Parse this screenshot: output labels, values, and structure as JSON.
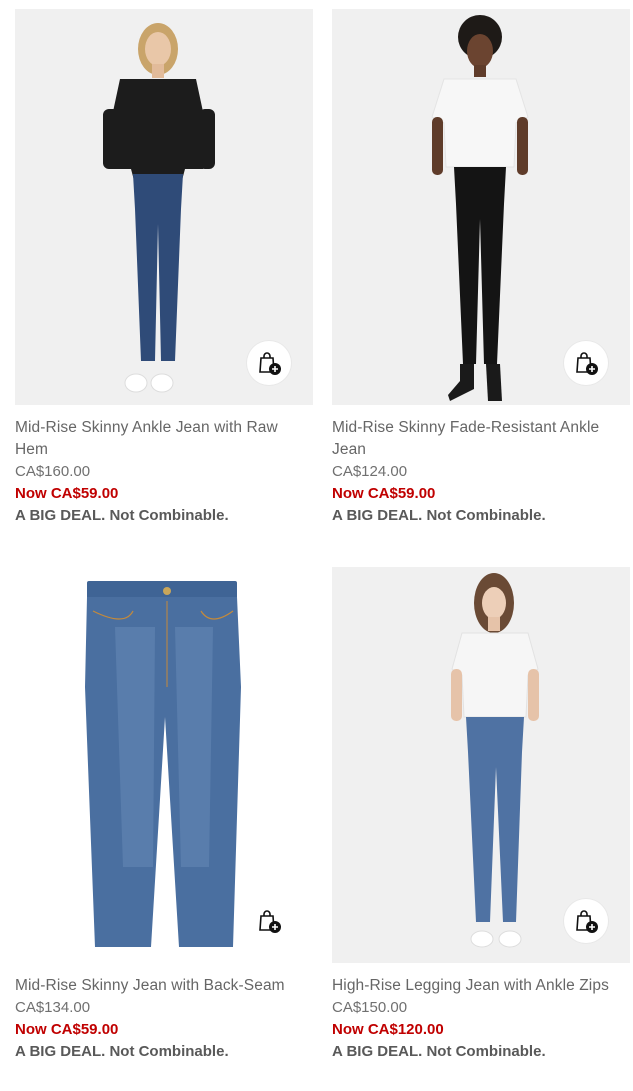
{
  "products": [
    {
      "title": "Mid-Rise Skinny Ankle Jean with Raw Hem",
      "price_was": "CA$160.00",
      "price_now": "Now CA$59.00",
      "promo": "A BIG DEAL. Not Combinable.",
      "icon": "quick-add-bag-icon"
    },
    {
      "title": "Mid-Rise Skinny Fade-Resistant Ankle Jean",
      "price_was": "CA$124.00",
      "price_now": "Now CA$59.00",
      "promo": "A BIG DEAL. Not Combinable.",
      "icon": "quick-add-bag-icon"
    },
    {
      "title": "Mid-Rise Skinny Jean with Back-Seam",
      "price_was": "CA$134.00",
      "price_now": "Now CA$59.00",
      "promo": "A BIG DEAL. Not Combinable.",
      "icon": "quick-add-bag-icon"
    },
    {
      "title": "High-Rise Legging Jean with Ankle Zips",
      "price_was": "CA$150.00",
      "price_now": "Now CA$120.00",
      "promo": "A BIG DEAL. Not Combinable.",
      "icon": "quick-add-bag-icon"
    }
  ],
  "colors": {
    "sale_red": "#c00000",
    "text_gray": "#666666",
    "image_bg": "#f1f1f1"
  }
}
